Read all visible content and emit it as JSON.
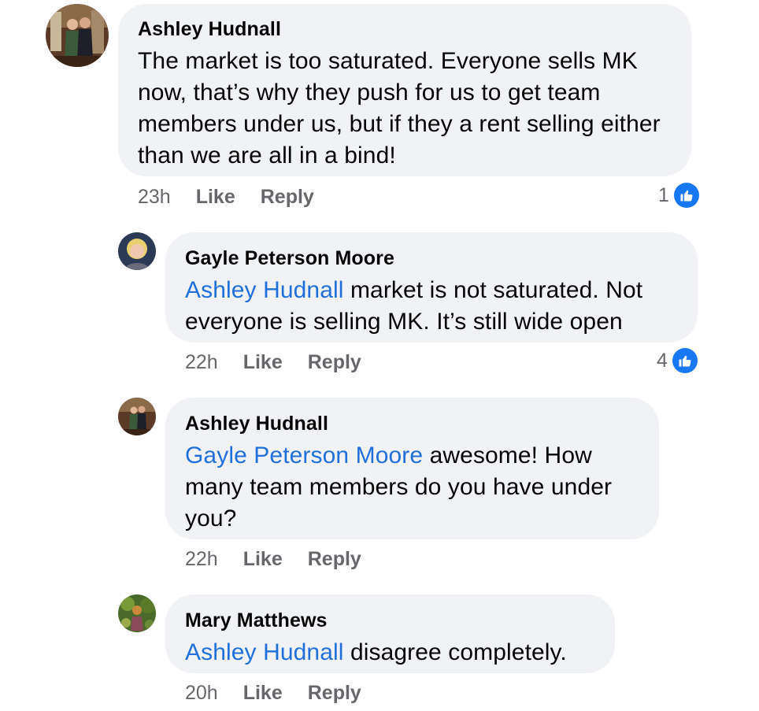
{
  "comments": [
    {
      "author": "Ashley Hudnall",
      "mention": "",
      "text": "The market is too saturated. Everyone sells MK now, that’s why they push for us to get team members under us, but if they a rent selling either than we are all in a bind!",
      "time": "23h",
      "like_label": "Like",
      "reply_label": "Reply",
      "reaction_count": "1"
    },
    {
      "author": "Gayle Peterson Moore",
      "mention": "Ashley Hudnall",
      "text": " market is not saturated. Not everyone is selling MK. It’s still wide open",
      "time": "22h",
      "like_label": "Like",
      "reply_label": "Reply",
      "reaction_count": "4"
    },
    {
      "author": "Ashley Hudnall",
      "mention": "Gayle Peterson Moore",
      "text": " awesome! How many team members do you have under you?",
      "time": "22h",
      "like_label": "Like",
      "reply_label": "Reply",
      "reaction_count": ""
    },
    {
      "author": "Mary Matthews",
      "mention": "Ashley Hudnall",
      "text": " disagree completely.",
      "time": "20h",
      "like_label": "Like",
      "reply_label": "Reply",
      "reaction_count": ""
    }
  ],
  "colors": {
    "bubble": "#f0f2f5",
    "mention": "#216fdb",
    "meta": "#65676b",
    "like_badge": "#1877f2"
  },
  "icons": {
    "reaction": "thumbs-up-icon"
  }
}
